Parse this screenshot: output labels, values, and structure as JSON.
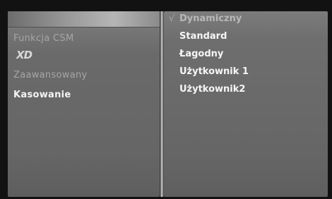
{
  "left_menu": {
    "items": [
      {
        "label": "Funkcja CSM"
      },
      {
        "label": "XD"
      },
      {
        "label": "Zaawansowany"
      },
      {
        "label": "Kasowanie"
      }
    ]
  },
  "right_menu": {
    "check_mark": "√",
    "options": [
      {
        "label": "Dynamiczny",
        "selected": true
      },
      {
        "label": "Standard"
      },
      {
        "label": "Łagodny"
      },
      {
        "label": "Użytkownik 1"
      },
      {
        "label": "Użytkownik2"
      }
    ]
  }
}
